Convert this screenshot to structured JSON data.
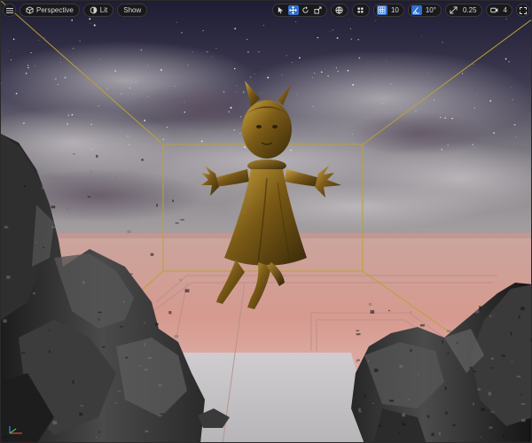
{
  "toolbar": {
    "viewport_type": "Perspective",
    "view_mode": "Lit",
    "show_label": "Show",
    "grid_snap_value": "10",
    "rotation_snap_value": "10°",
    "scale_snap_value": "0.25",
    "camera_speed_value": "4"
  },
  "icons": {
    "menu": "hamburger-menu-icon",
    "perspective": "perspective-cube-icon",
    "lit": "lit-sphere-icon",
    "select": "select-arrow-icon",
    "translate": "translate-cross-icon",
    "rotate": "rotate-icon",
    "scale": "scale-icon",
    "world": "world-globe-icon",
    "surface_snap": "surface-snap-icon",
    "grid_snap": "grid-snap-icon",
    "rotation_snap": "angle-snap-icon",
    "scale_snap": "scale-snap-icon",
    "camera_speed": "camera-speed-icon",
    "maximize": "maximize-icon"
  },
  "colors": {
    "active_tool": "#2e6fd6",
    "statue_gold": "#8a6a1a",
    "bounds_yellow": "#b9a233",
    "floor_pink": "#d69a8f"
  }
}
